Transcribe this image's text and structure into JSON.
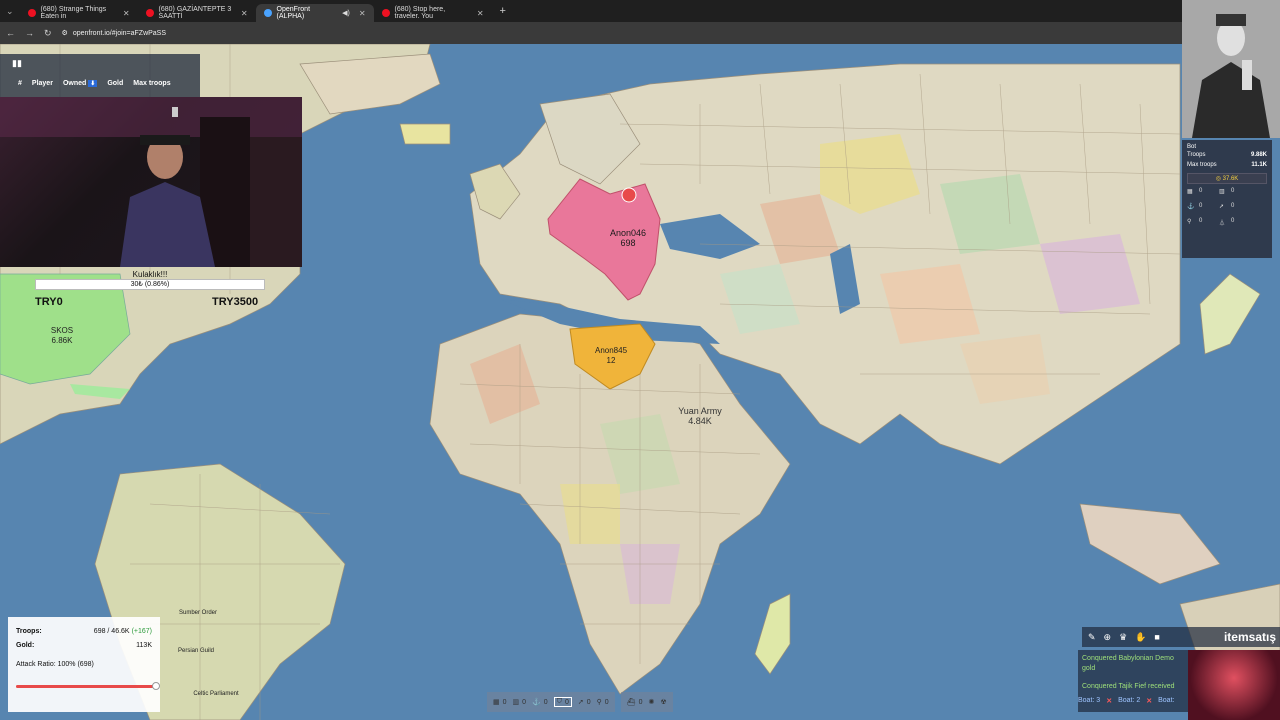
{
  "browser": {
    "tabs": [
      {
        "title": "(680) Strange Things Eaten in",
        "active": false
      },
      {
        "title": "(680) GAZİANTEPTE 3 SAATTİ",
        "active": false
      },
      {
        "title": "OpenFront (ALPHA)",
        "active": true
      },
      {
        "title": "(680) Stop here, traveler. You",
        "active": false
      }
    ],
    "url": "openfront.io/#join=aFZwPaSS"
  },
  "leaderboard": {
    "columns": [
      "#",
      "Player",
      "Owned",
      "Gold",
      "Max troops"
    ]
  },
  "overlay": {
    "kulaklik_title": "Kulaklık!!!",
    "kulaklik_value": "30₺ (0.86%)",
    "try_left": "TRY0",
    "try_right": "TRY3500"
  },
  "bot_panel": {
    "name": "Bot",
    "troops_label": "Troops",
    "troops_value": "9.88K",
    "max_troops_label": "Max troops",
    "max_troops_value": "11.1K",
    "gold_value": "37.6K",
    "stats": [
      "0",
      "0",
      "0",
      "0",
      "0",
      "0"
    ]
  },
  "map": {
    "players": [
      {
        "name": "Anon046",
        "troops": "698"
      },
      {
        "name": "Anon845",
        "troops": "12"
      },
      {
        "name": "Yuan Army",
        "troops": "4.84K"
      },
      {
        "name": "SKOS",
        "troops": "6.86K"
      }
    ],
    "small_labels": [
      "Sumber Order",
      "Persian Guild",
      "Celtic Parliament"
    ]
  },
  "troops_panel": {
    "troops_label": "Troops:",
    "troops_value": "698 / 46.6K",
    "troops_rate": "(+167)",
    "gold_label": "Gold:",
    "gold_value": "113K",
    "attack_ratio_label": "Attack Ratio: 100% (698)",
    "attack_ratio": 1.0
  },
  "build_bar": {
    "counts": [
      "0",
      "0",
      "0",
      "0",
      "0",
      "0",
      "0",
      "0"
    ]
  },
  "chat": {
    "logo_text": "itemsatış",
    "events": [
      "Conquered Babylonian Demo",
      "gold",
      "Conquered Tajik Fief received"
    ],
    "boats": [
      "Boat: 3",
      "Boat: 2",
      "Boat:"
    ]
  },
  "colors": {
    "ocean": "#5785b0",
    "player_pink": "#e9779a",
    "player_yellow": "#f0b43a",
    "accent_red": "#e84a4a"
  }
}
